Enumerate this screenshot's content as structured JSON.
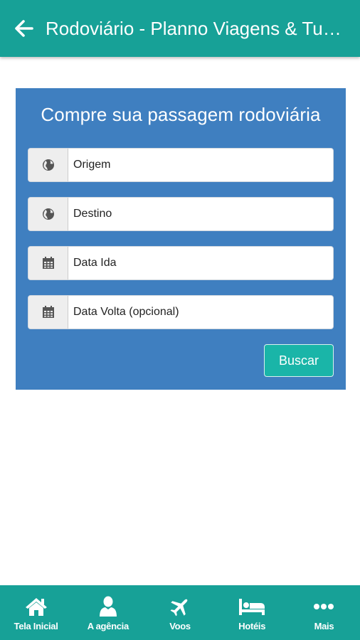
{
  "header": {
    "title": "Rodoviário - Planno Viagens & Turismo",
    "back_icon": "arrow-left-icon"
  },
  "search": {
    "title": "Compre sua passagem rodoviária",
    "fields": [
      {
        "label": "Origem",
        "icon": "globe-icon"
      },
      {
        "label": "Destino",
        "icon": "globe-icon"
      },
      {
        "label": "Data Ida",
        "icon": "calendar-icon"
      },
      {
        "label": "Data Volta (opcional)",
        "icon": "calendar-icon"
      }
    ],
    "button_label": "Buscar"
  },
  "tabbar": {
    "items": [
      {
        "label": "Tela Inicial",
        "icon": "home-icon"
      },
      {
        "label": "A agência",
        "icon": "user-icon"
      },
      {
        "label": "Voos",
        "icon": "plane-icon"
      },
      {
        "label": "Hotéis",
        "icon": "bed-icon"
      },
      {
        "label": "Mais",
        "icon": "more-icon"
      }
    ]
  },
  "colors": {
    "primary": "#17a197",
    "card": "#3f7fc0",
    "button": "#1ab5a8"
  }
}
